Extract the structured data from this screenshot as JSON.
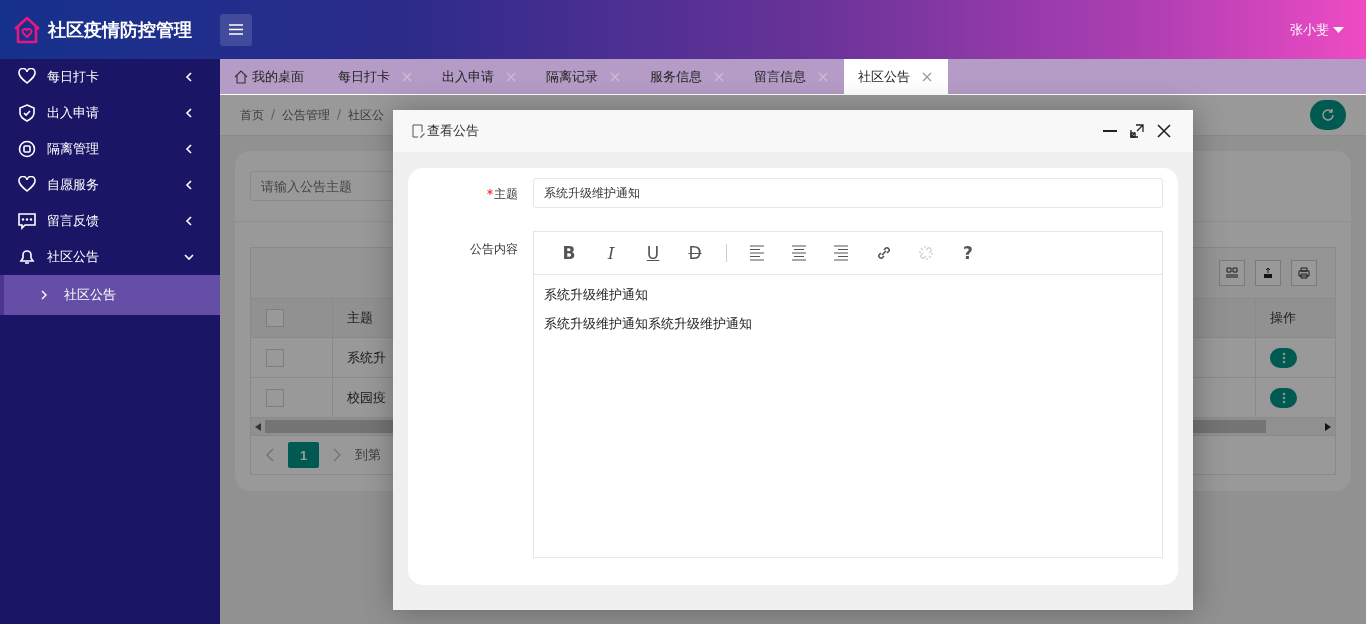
{
  "header": {
    "title": "社区疫情防控管理",
    "user": "张小斐"
  },
  "sidebar": {
    "items": [
      {
        "label": "每日打卡",
        "expanded": false
      },
      {
        "label": "出入申请",
        "expanded": false
      },
      {
        "label": "隔离管理",
        "expanded": false
      },
      {
        "label": "自愿服务",
        "expanded": false
      },
      {
        "label": "留言反馈",
        "expanded": false
      },
      {
        "label": "社区公告",
        "expanded": true,
        "children": [
          {
            "label": "社区公告",
            "selected": true
          }
        ]
      }
    ]
  },
  "tabs": [
    {
      "kind": "home",
      "label": "我的桌面",
      "selected": false
    },
    {
      "kind": "page",
      "label": "每日打卡",
      "selected": false
    },
    {
      "kind": "page",
      "label": "出入申请",
      "selected": false
    },
    {
      "kind": "page",
      "label": "隔离记录",
      "selected": false
    },
    {
      "kind": "page",
      "label": "服务信息",
      "selected": false
    },
    {
      "kind": "page",
      "label": "留言信息",
      "selected": false
    },
    {
      "kind": "page",
      "label": "社区公告",
      "selected": true
    }
  ],
  "breadcrumb": {
    "separator": "/",
    "items": [
      "首页",
      "公告管理",
      "社区公"
    ]
  },
  "search": {
    "placeholder": "请输入公告主题"
  },
  "table": {
    "columns": [
      "主题",
      "操作"
    ],
    "rows": [
      {
        "checked": false,
        "topic": "系统升"
      },
      {
        "checked": false,
        "topic": "校园疫"
      }
    ],
    "header_checked": false
  },
  "pagination": {
    "current": "1",
    "goto": "到第"
  },
  "dialog": {
    "title": "查看公告",
    "subject": {
      "label": "主题",
      "required": true,
      "value": "系统升级维护通知"
    },
    "content": {
      "label": "公告内容",
      "paragraphs": [
        "系统升级维护通知",
        "系统升级维护通知系统升级维护通知"
      ]
    },
    "tools": [
      {
        "kind": "bold",
        "text": "B",
        "disabled": false
      },
      {
        "kind": "italic",
        "text": "I",
        "disabled": false
      },
      {
        "kind": "underline",
        "text": "U",
        "disabled": false
      },
      {
        "kind": "strike",
        "text": "D",
        "disabled": false
      },
      {
        "kind": "separator"
      },
      {
        "kind": "align-left",
        "disabled": false
      },
      {
        "kind": "align-center",
        "disabled": false
      },
      {
        "kind": "align-right",
        "disabled": false
      },
      {
        "kind": "link",
        "disabled": false
      },
      {
        "kind": "unlink",
        "disabled": true
      },
      {
        "kind": "help",
        "text": "?",
        "disabled": false
      }
    ]
  }
}
